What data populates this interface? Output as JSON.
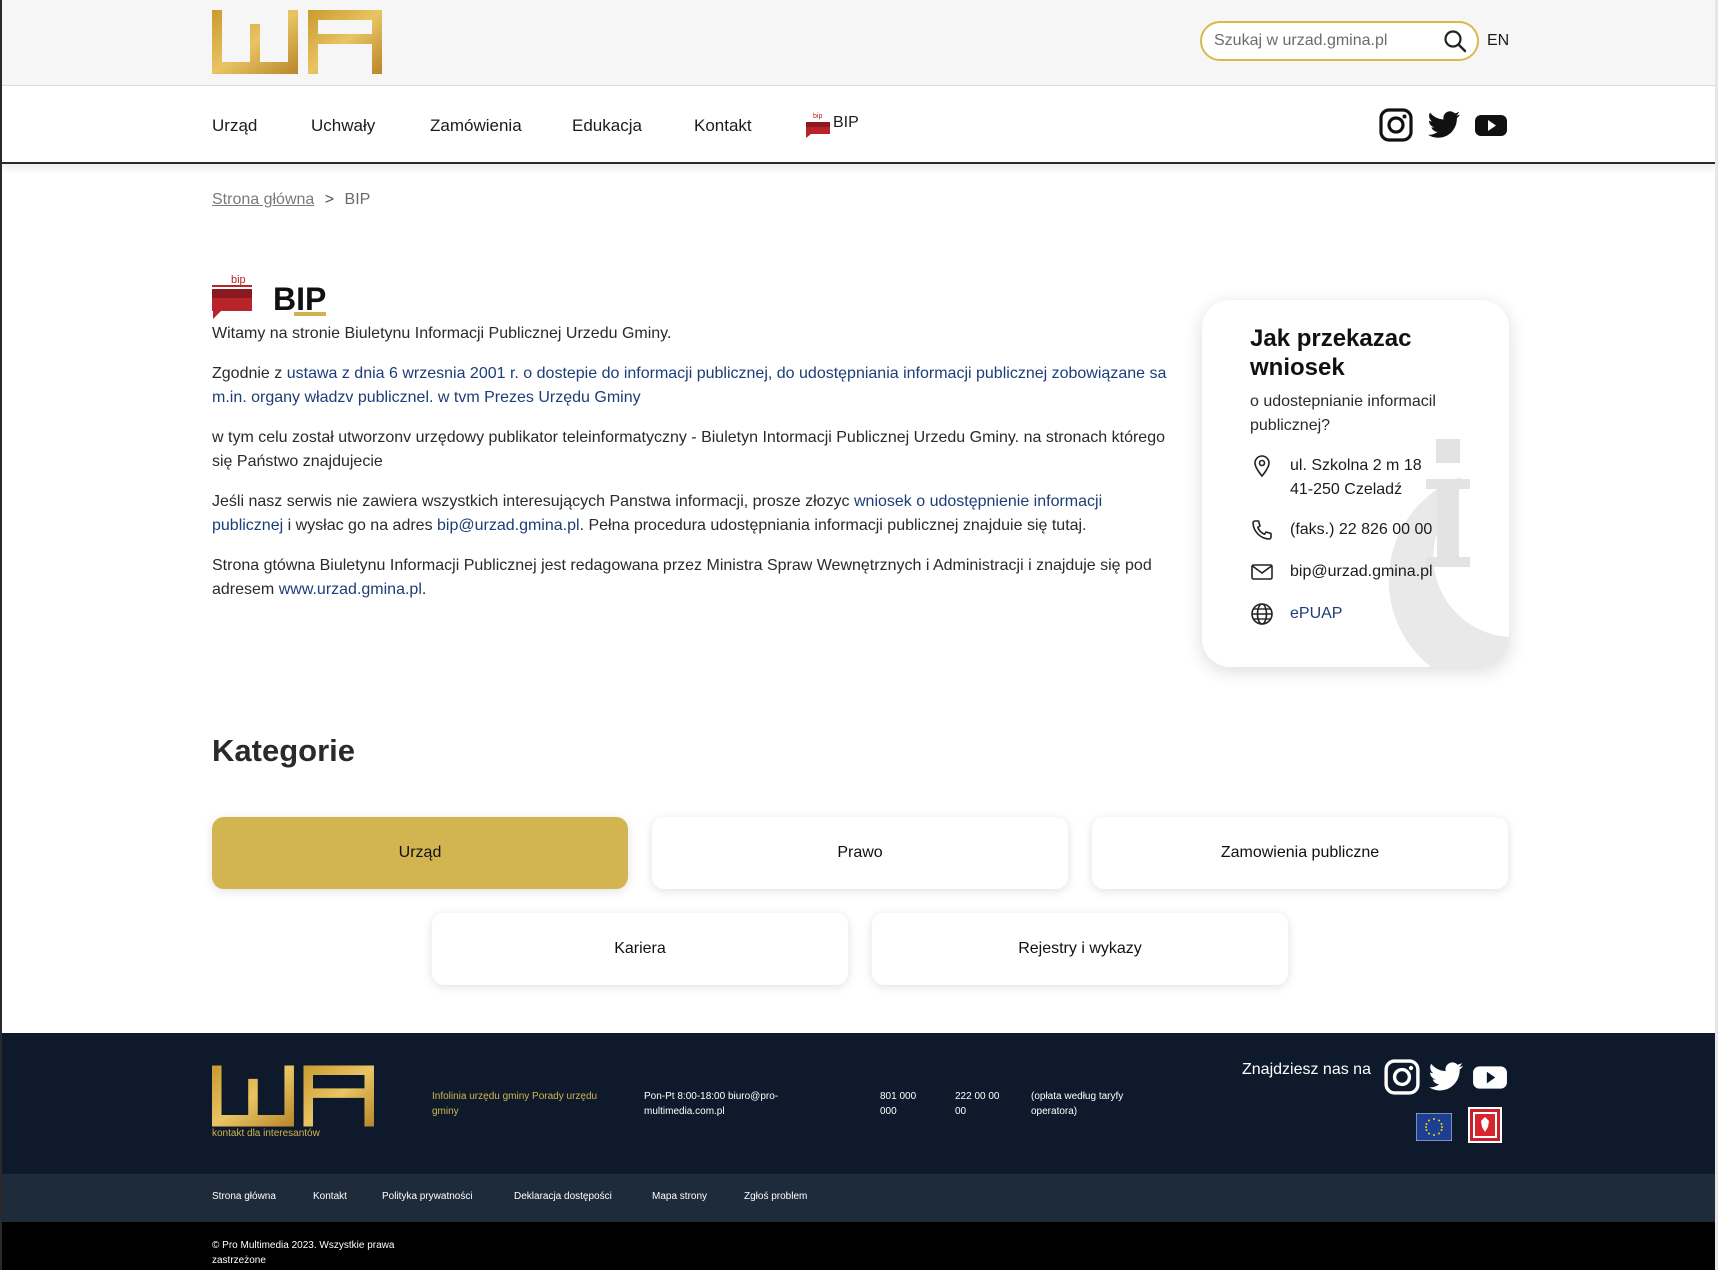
{
  "header": {
    "search_placeholder": "Szukaj w urzad.gmina.pl",
    "lang": "EN"
  },
  "nav": {
    "items": [
      "Urząd",
      "Uchwały",
      "Zamówienia",
      "Edukacja",
      "Kontakt"
    ],
    "bip_label": "BIP"
  },
  "breadcrumb": {
    "home": "Strona główna",
    "separator": ">",
    "current": "BIP"
  },
  "page": {
    "title": "BIP",
    "p1": "Witamy na stronie Biuletynu Informacji Publicznej Urzedu Gminy.",
    "p2_prefix": "Zgodnie z ",
    "p2_link": "ustawa z dnia 6 wrzesnia 2001 r. o dostepie do informacji publicznej, do udostępniania informacji publicznej zobowiązane sa m.in. organy władzv publicznel. w tvm Prezes Urzędu Gminy",
    "p3": "w tym celu został utworzonv urzędowy publikator teleinformatyczny - Biuletyn Intormacji Publicznej Urzedu Gminy. na stronach którego się Państwo znajdujecie",
    "p4_prefix": "Jeśli nasz serwis nie zawiera wszystkich interesujących Panstwa informacji, prosze złozyc ",
    "p4_link1": "wniosek o udostępnienie informacji publicznej",
    "p4_mid": " i wysłac go na adres ",
    "p4_link2": "bip@urzad.gmina.pl",
    "p4_suffix": ". Pełna procedura udostępniania informacji publicznej znajduie się tutaj.",
    "p5_prefix": "Strona gtówna Biuletynu Informacji Publicznej jest redagowana przez Ministra Spraw Wewnętrznych i Administracji i znajduje się pod adresem ",
    "p5_link": "www.urzad.gmina.pl",
    "p5_suffix": "."
  },
  "card": {
    "title": "Jak przekazac wniosek",
    "subtitle": "o udostepnianie informacil publicznej?",
    "address_line1": "ul. Szkolna 2 m 18",
    "address_line2": "41-250 Czeladź",
    "phone": "(faks.) 22 826 00 00",
    "email": "bip@urzad.gmina.pl",
    "epuap": "ePUAP"
  },
  "categories": {
    "heading": "Kategorie",
    "items": [
      "Urząd",
      "Prawo",
      "Zamowienia publiczne",
      "Kariera",
      "Rejestry i wykazy"
    ],
    "active_index": 0
  },
  "footer": {
    "tagline": "kontakt dla interesantów",
    "infoline": "Infolinia urzędu gminy Porady urzędu gminy",
    "hours": "Pon-Pt 8:00-18:00 biuro@pro-multimedia.com.pl",
    "phone1": "801 000 000",
    "phone2": "222 00 00 00",
    "rate_note": "(opłata według taryfy operatora)",
    "find_us": "Znajdziesz nas na",
    "links": [
      "Strona główna",
      "Kontakt",
      "Polityka prywatności",
      "Deklaracja dostępości",
      "Mapa strony",
      "Zgłoś problem"
    ],
    "copyright": "© Pro Multimedia 2023. Wszystkie prawa zastrzeżone"
  },
  "colors": {
    "gold": "#d2b450",
    "footer_dark": "#0e1a2b",
    "link_blue": "#1d3d78"
  }
}
